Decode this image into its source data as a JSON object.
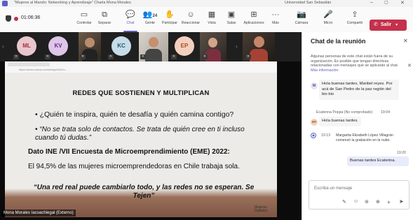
{
  "window": {
    "title": "\"Mujeres al Mando: Networking y Aprendizaje\" Charla Mona Morales",
    "org": "Universidad San Sebastián"
  },
  "toolbar": {
    "timer": "01:06:36",
    "buttons": [
      {
        "label": "Controlar",
        "icon": "monitor-icon"
      },
      {
        "label": "Separar",
        "icon": "popout-icon"
      },
      {
        "label": "Chat",
        "icon": "chat-icon",
        "active": true
      },
      {
        "label": "Gente",
        "icon": "people-icon",
        "count": "24"
      },
      {
        "label": "Participar",
        "icon": "hand-icon"
      },
      {
        "label": "Reaccionar",
        "icon": "emoji-icon"
      },
      {
        "label": "Vista",
        "icon": "grid-icon"
      },
      {
        "label": "Salas",
        "icon": "rooms-icon"
      },
      {
        "label": "Aplicaciones",
        "icon": "apps-icon"
      },
      {
        "label": "Más",
        "icon": "more-icon"
      }
    ],
    "camera_label": "Cámara",
    "mic_label": "Micro",
    "share_label": "Compartir",
    "leave_label": "Salir"
  },
  "participants": [
    {
      "initials": "ML",
      "bg": "#e8c6cc",
      "fg": "#a7303f"
    },
    {
      "initials": "KV",
      "bg": "#ddc6e8",
      "fg": "#6d2a8a"
    },
    {
      "initials": "KC",
      "bg": "#c6dce8",
      "fg": "#20566f"
    },
    {
      "initials": "EP",
      "bg": "#f2d0c0",
      "fg": "#b04a1f"
    }
  ],
  "slide": {
    "browser_url": "https://www.canva.com/design/DAGx...",
    "title": "REDES QUE SOSTIENEN Y MULTIPLICAN",
    "bullet1": "• ¿Quién te inspira, quién te desafía y quién camina contigo?",
    "bullet2": "• “No se trata solo de contactos. Se trata de quién cree en ti incluso cuando tú dudas.”",
    "data_title": "Dato INE /VII Encuesta de Microemprendimiento (EME) 2022:",
    "data_text": "El 94,5% de las mujeres microemprendedoras en Chile trabaja sola.",
    "quote": "“Una red real puede cambiarlo todo, y las redes no se esperan. Se Tejen”",
    "logo": "Mujeres Digitales"
  },
  "presenter_name": "Mona Morales Iacoachiegal (Externo)",
  "chat": {
    "title": "Chat de la reunión",
    "notice": "Algunas personas de este chat están fuera de su organización. Es posible que tengan directivas relacionadas con mensajes que se aplicarán al chat.",
    "notice_link": "Más información",
    "messages": [
      {
        "avatar": "M",
        "avatar_bg": "#e9e3f3",
        "avatar_fg": "#6a5096",
        "text": "Hola buenas tardes, Maribel reyes. Por acá de San Pedro de la paz región del bio bio"
      },
      {
        "sender": "Ecatenna Peppa (No comprobado)",
        "time": "19:04",
        "avatar": "EP",
        "avatar_bg": "#f2d0c0",
        "avatar_fg": "#b04a1f",
        "text": "Hola buenas tardes."
      }
    ],
    "system": {
      "time": "19:13",
      "text": "Margarita Elizabeth López Villagrán comenzó la grabación en la nube."
    },
    "own": {
      "time": "19:20",
      "text": "Buenas tardes Ecaterina."
    },
    "compose_placeholder": "Escriba un mensaje"
  }
}
